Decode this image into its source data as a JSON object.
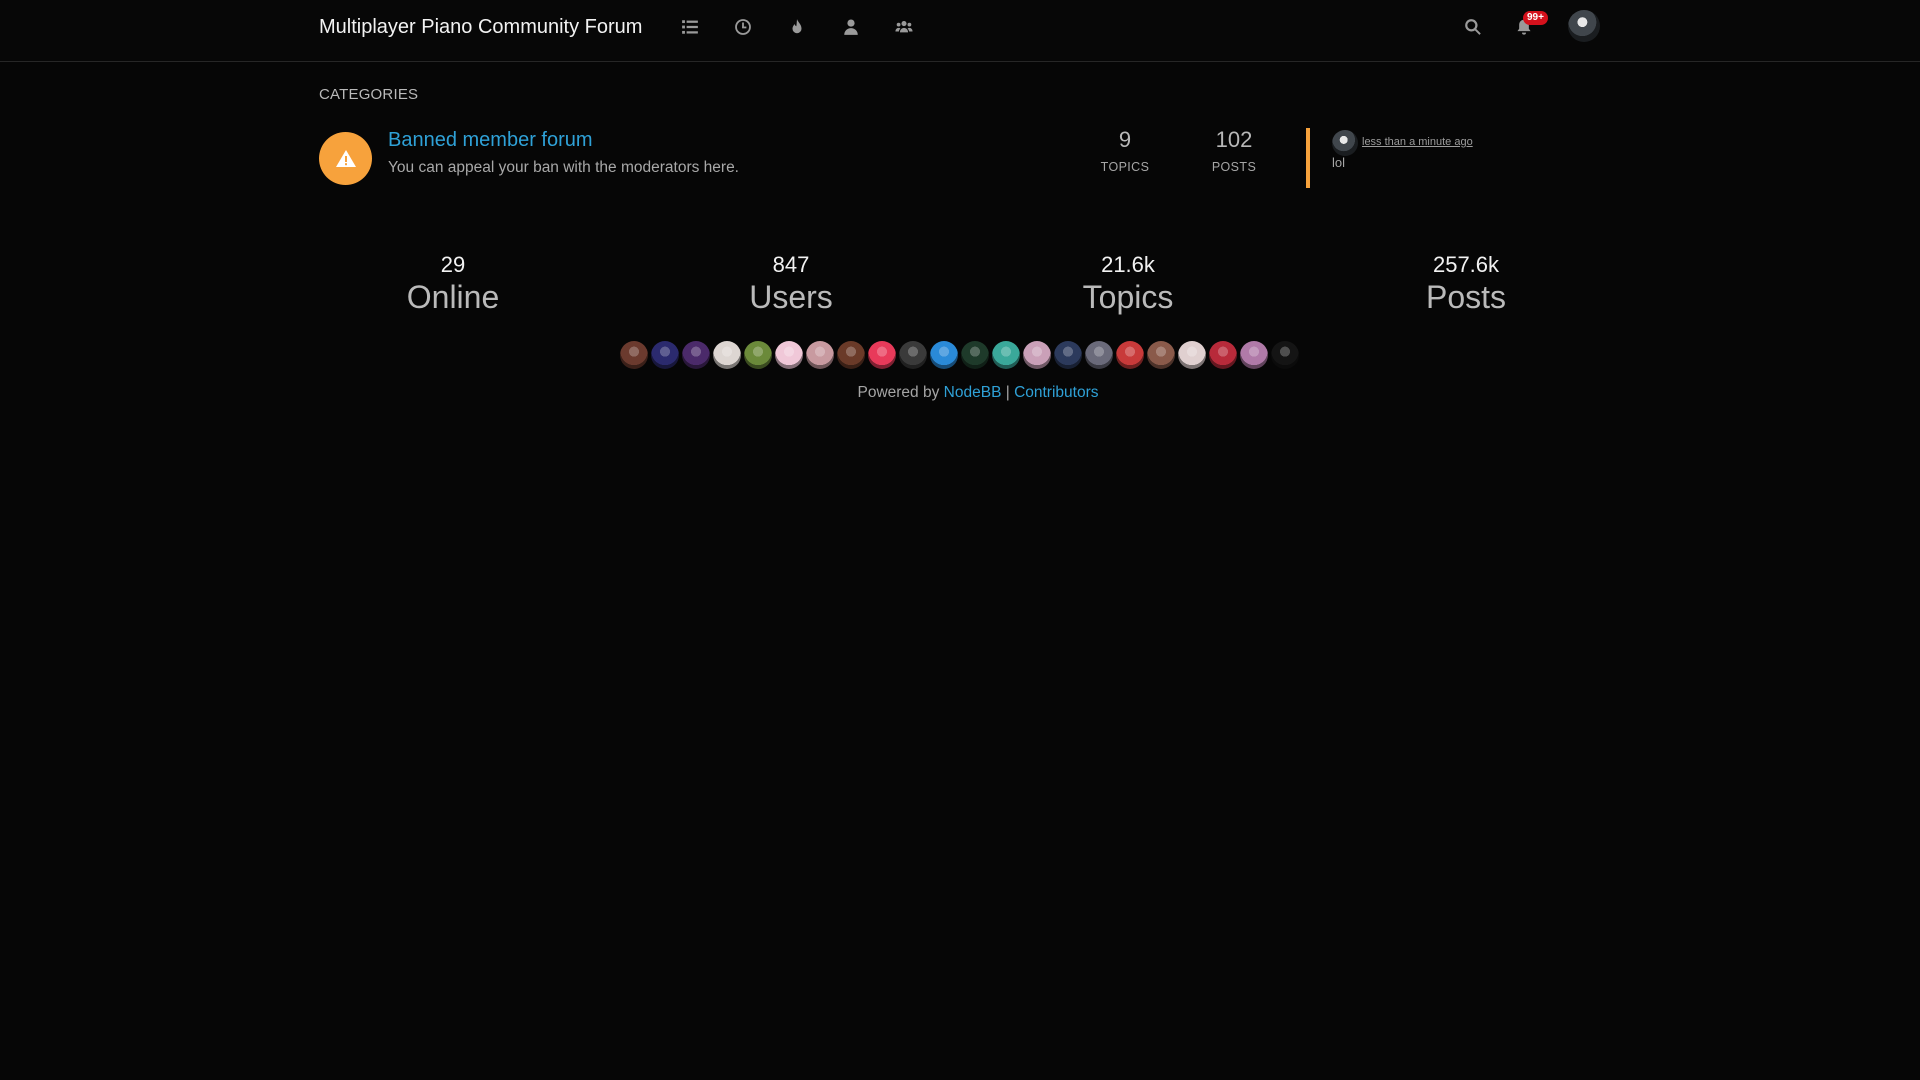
{
  "navbar": {
    "brand": "Multiplayer Piano Community Forum",
    "icons": [
      "categories-icon",
      "recent-icon",
      "popular-icon",
      "users-icon",
      "groups-icon",
      "search-icon",
      "notifications-icon"
    ],
    "notification_badge": "99+"
  },
  "categories": {
    "heading": "CATEGORIES",
    "items": [
      {
        "title": "Banned member forum",
        "description": "You can appeal your ban with the moderators here.",
        "icon": "warning-icon",
        "color": "#f7a23c",
        "topics": "9",
        "topics_label": "TOPICS",
        "posts": "102",
        "posts_label": "POSTS",
        "teaser": {
          "time": "less than a minute ago",
          "text": "lol"
        }
      }
    ]
  },
  "stats": [
    {
      "value": "29",
      "label": "Online"
    },
    {
      "value": "847",
      "label": "Users"
    },
    {
      "value": "21.6k",
      "label": "Topics"
    },
    {
      "value": "257.6k",
      "label": "Posts"
    }
  ],
  "online_avatar_colors": [
    "#6b3a2e",
    "#2b2a6e",
    "#4b2a6a",
    "#ddd6d2",
    "#6b8a3a",
    "#f0c8d8",
    "#c89aa0",
    "#6a3a28",
    "#e83a5a",
    "#3a3a3a",
    "#2a8ad8",
    "#1e3a2a",
    "#3aa89a",
    "#caa0b8",
    "#2c3a5c",
    "#6a6a7a",
    "#c83a3a",
    "#8a5a4a",
    "#e0d0d0",
    "#b82a3a",
    "#b07aa8",
    "#141414"
  ],
  "footer": {
    "prefix": "Powered by",
    "nodebb": "NodeBB",
    "separator": "|",
    "contributors": "Contributors"
  },
  "colors": {
    "background": "#060606",
    "link": "#2fa1d7",
    "accent": "#f7a23c",
    "badge": "#d4111c"
  }
}
